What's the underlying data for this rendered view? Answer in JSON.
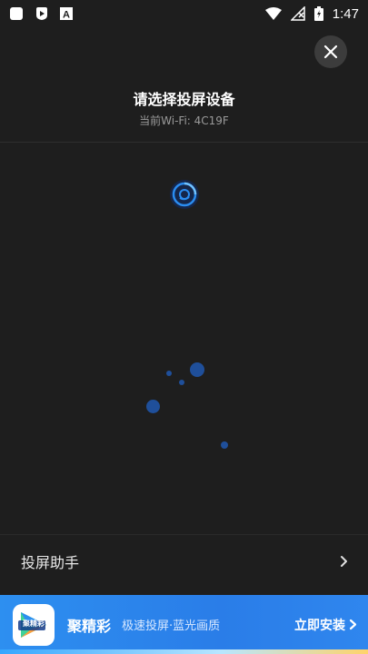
{
  "status_bar": {
    "time": "1:47",
    "left_icons": [
      "square-notification-icon",
      "shield-app-icon",
      "font-a-icon"
    ],
    "right_icons": [
      "wifi-icon",
      "no-signal-icon",
      "battery-charging-icon"
    ]
  },
  "dialog": {
    "title": "请选择投屏设备",
    "wifi_label": "当前Wi-Fi: 4C19F",
    "close_icon": "close-icon"
  },
  "scanning": {
    "icon": "scan-radar-icon",
    "accent_color": "#2a8cf0",
    "dot_color": "#1f4f9a"
  },
  "assistant": {
    "label": "投屏助手",
    "chevron_icon": "chevron-right-icon"
  },
  "ad_banner": {
    "logo_text": "聚精彩",
    "app_name": "聚精彩",
    "description": "极速投屏·蓝光画质",
    "install_label": "立即安装",
    "background_color": "#2d8ff0"
  },
  "colors": {
    "background": "#1e1e1e",
    "close_button": "#3c3c3c",
    "subtitle": "#9a9a9a"
  }
}
